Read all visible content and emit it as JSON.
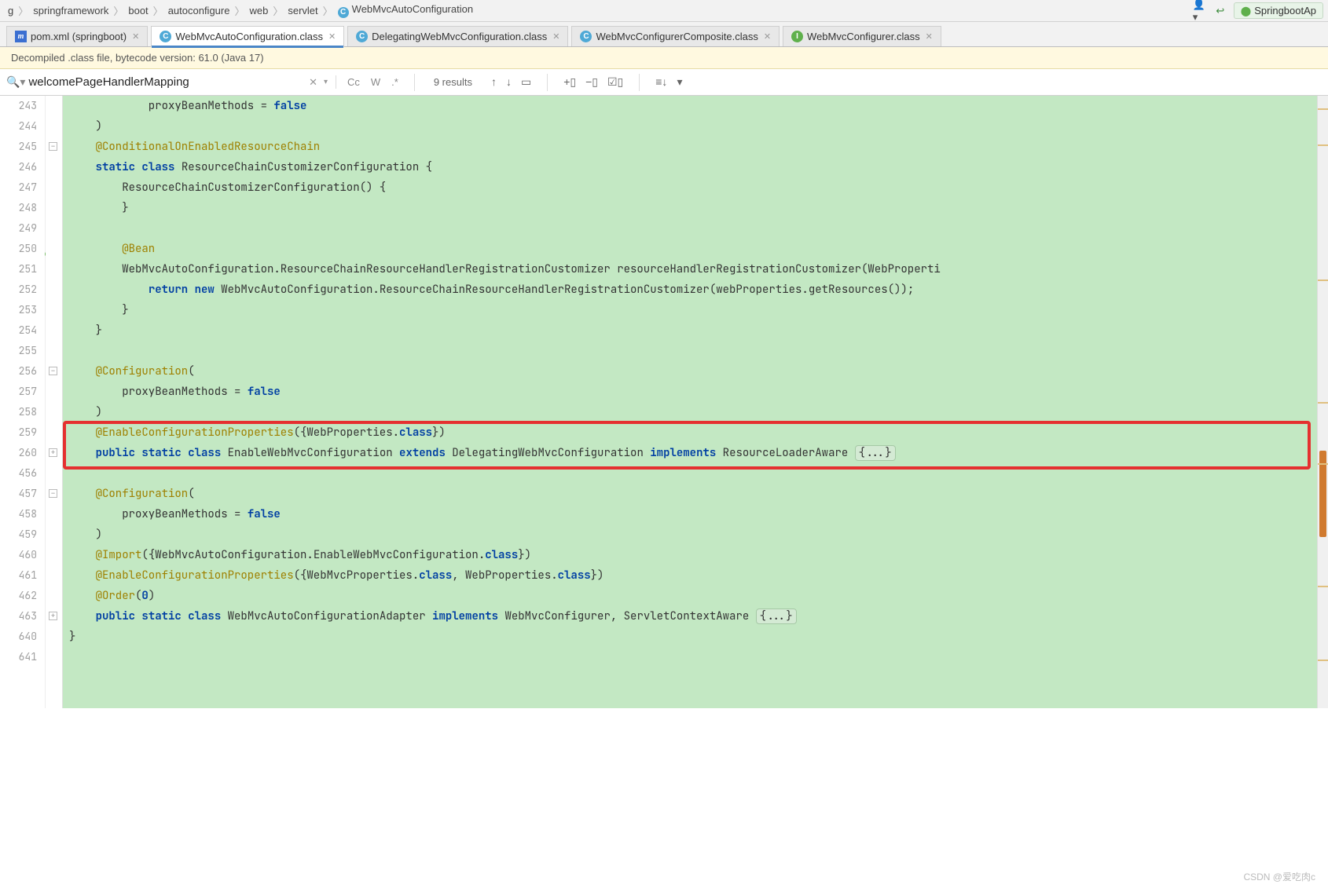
{
  "breadcrumb": {
    "items": [
      "g",
      "springframework",
      "boot",
      "autoconfigure",
      "web",
      "servlet"
    ],
    "current": "WebMvcAutoConfiguration"
  },
  "runTarget": "SpringbootAp",
  "tabs": [
    {
      "icon": "m",
      "label": "pom.xml (springboot)",
      "active": false
    },
    {
      "icon": "c",
      "label": "WebMvcAutoConfiguration.class",
      "active": true
    },
    {
      "icon": "c",
      "label": "DelegatingWebMvcConfiguration.class",
      "active": false
    },
    {
      "icon": "c",
      "label": "WebMvcConfigurerComposite.class",
      "active": false
    },
    {
      "icon": "i",
      "label": "WebMvcConfigurer.class",
      "active": false
    }
  ],
  "notice": "Decompiled .class file, bytecode version: 61.0 (Java 17)",
  "find": {
    "query": "welcomePageHandlerMapping",
    "resultsLabel": "9 results",
    "cc": "Cc",
    "w": "W",
    "regex": ".*",
    "upIcon": "↑",
    "downIcon": "↓",
    "selIcon": "▭",
    "addsel": "+▯",
    "remsel": "−▯",
    "check": "☑▯",
    "cols": "≡↓",
    "filter": "▾"
  },
  "gutterLines": [
    "243",
    "244",
    "245",
    "246",
    "247",
    "248",
    "249",
    "250",
    "251",
    "252",
    "253",
    "254",
    "255",
    "256",
    "257",
    "258",
    "259",
    "260",
    "456",
    "457",
    "458",
    "459",
    "460",
    "461",
    "462",
    "463",
    "640",
    "641"
  ],
  "gutterIconAt": 7,
  "foldMarks": [
    {
      "topIndex": 2,
      "sym": "−"
    },
    {
      "topIndex": 13,
      "sym": "−"
    },
    {
      "topIndex": 17,
      "sym": "+"
    },
    {
      "topIndex": 19,
      "sym": "−"
    },
    {
      "topIndex": 25,
      "sym": "+"
    }
  ],
  "code": [
    [
      {
        "t": "            proxyBeanMethods = "
      },
      {
        "t": "false",
        "c": "lit"
      }
    ],
    [
      {
        "t": "    )"
      }
    ],
    [
      {
        "t": "    "
      },
      {
        "t": "@ConditionalOnEnabledResourceChain",
        "c": "an"
      }
    ],
    [
      {
        "t": "    "
      },
      {
        "t": "static",
        "c": "kw"
      },
      {
        "t": " "
      },
      {
        "t": "class",
        "c": "kw"
      },
      {
        "t": " ResourceChainCustomizerConfiguration {"
      }
    ],
    [
      {
        "t": "        ResourceChainCustomizerConfiguration() {"
      }
    ],
    [
      {
        "t": "        }"
      }
    ],
    [
      {
        "t": ""
      }
    ],
    [
      {
        "t": "        "
      },
      {
        "t": "@Bean",
        "c": "an"
      }
    ],
    [
      {
        "t": "        WebMvcAutoConfiguration.ResourceChainResourceHandlerRegistrationCustomizer resourceHandlerRegistrationCustomizer(WebProperti"
      }
    ],
    [
      {
        "t": "            "
      },
      {
        "t": "return",
        "c": "kw"
      },
      {
        "t": " "
      },
      {
        "t": "new",
        "c": "kw"
      },
      {
        "t": " WebMvcAutoConfiguration.ResourceChainResourceHandlerRegistrationCustomizer(webProperties.getResources());"
      }
    ],
    [
      {
        "t": "        }"
      }
    ],
    [
      {
        "t": "    }"
      }
    ],
    [
      {
        "t": ""
      }
    ],
    [
      {
        "t": "    "
      },
      {
        "t": "@Configuration",
        "c": "an"
      },
      {
        "t": "("
      }
    ],
    [
      {
        "t": "        proxyBeanMethods = "
      },
      {
        "t": "false",
        "c": "lit"
      }
    ],
    [
      {
        "t": "    )"
      }
    ],
    [
      {
        "t": "    "
      },
      {
        "t": "@EnableConfigurationProperties",
        "c": "an"
      },
      {
        "t": "({WebProperties."
      },
      {
        "t": "class",
        "c": "kw"
      },
      {
        "t": "})"
      }
    ],
    [
      {
        "t": "    "
      },
      {
        "t": "public",
        "c": "kw"
      },
      {
        "t": " "
      },
      {
        "t": "static",
        "c": "kw"
      },
      {
        "t": " "
      },
      {
        "t": "class",
        "c": "kw"
      },
      {
        "t": " EnableWebMvcConfiguration "
      },
      {
        "t": "extends",
        "c": "kw"
      },
      {
        "t": " DelegatingWebMvcConfiguration "
      },
      {
        "t": "implements",
        "c": "kw"
      },
      {
        "t": " ResourceLoaderAware "
      },
      {
        "t": "{...}",
        "c": "fold-bubble"
      }
    ],
    [
      {
        "t": ""
      }
    ],
    [
      {
        "t": "    "
      },
      {
        "t": "@Configuration",
        "c": "an"
      },
      {
        "t": "("
      }
    ],
    [
      {
        "t": "        proxyBeanMethods = "
      },
      {
        "t": "false",
        "c": "lit"
      }
    ],
    [
      {
        "t": "    )"
      }
    ],
    [
      {
        "t": "    "
      },
      {
        "t": "@Import",
        "c": "an"
      },
      {
        "t": "({WebMvcAutoConfiguration.EnableWebMvcConfiguration."
      },
      {
        "t": "class",
        "c": "kw"
      },
      {
        "t": "})"
      }
    ],
    [
      {
        "t": "    "
      },
      {
        "t": "@EnableConfigurationProperties",
        "c": "an"
      },
      {
        "t": "({WebMvcProperties."
      },
      {
        "t": "class",
        "c": "kw"
      },
      {
        "t": ", WebProperties."
      },
      {
        "t": "class",
        "c": "kw"
      },
      {
        "t": "})"
      }
    ],
    [
      {
        "t": "    "
      },
      {
        "t": "@Order",
        "c": "an"
      },
      {
        "t": "("
      },
      {
        "t": "0",
        "c": "lit"
      },
      {
        "t": ")"
      }
    ],
    [
      {
        "t": "    "
      },
      {
        "t": "public",
        "c": "kw"
      },
      {
        "t": " "
      },
      {
        "t": "static",
        "c": "kw"
      },
      {
        "t": " "
      },
      {
        "t": "class",
        "c": "kw"
      },
      {
        "t": " WebMvcAutoConfigurationAdapter "
      },
      {
        "t": "implements",
        "c": "kw"
      },
      {
        "t": " WebMvcConfigurer, ServletContextAware "
      },
      {
        "t": "{...}",
        "c": "fold-bubble"
      }
    ],
    [
      {
        "t": "}"
      }
    ],
    [
      {
        "t": ""
      }
    ]
  ],
  "highlightBox": {
    "topLine": 16,
    "lines": 2
  },
  "scroll": {
    "thumbTop": 0.58,
    "thumbH": 0.14,
    "marks": [
      0.02,
      0.08,
      0.3,
      0.5,
      0.6,
      0.8,
      0.92
    ]
  },
  "watermark": "CSDN @爱吃肉c"
}
